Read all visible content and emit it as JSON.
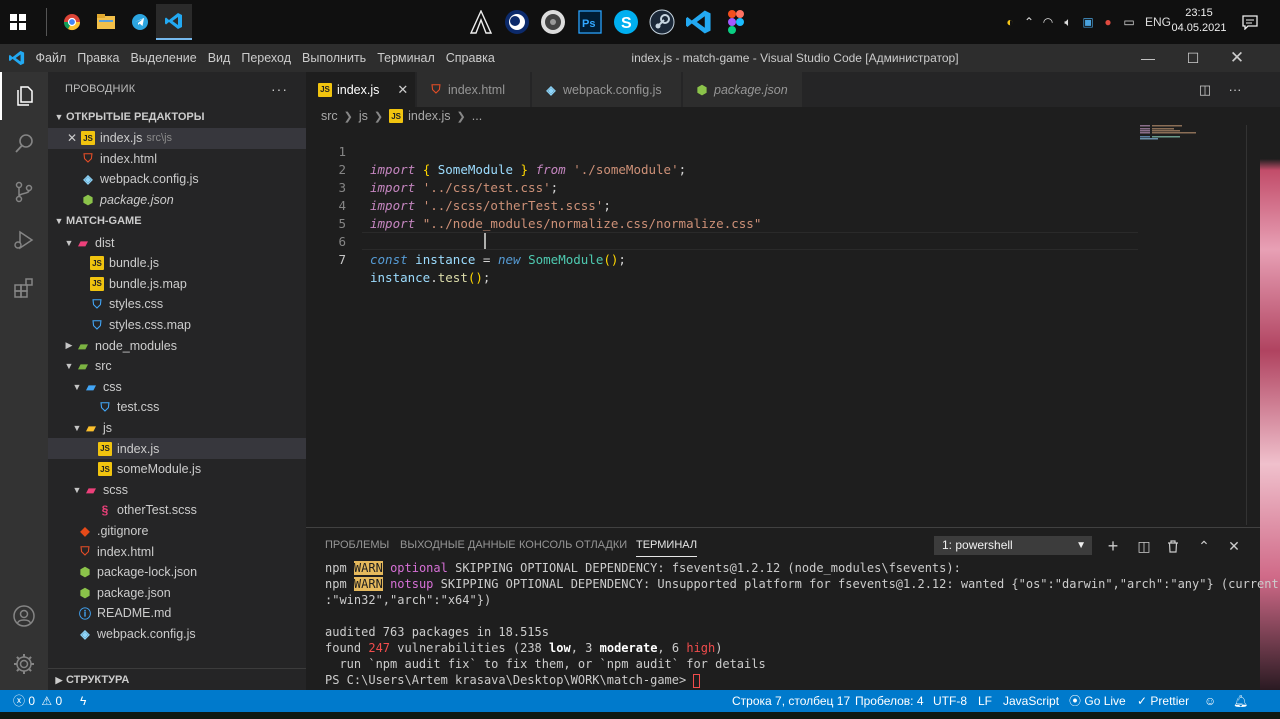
{
  "taskbar": {
    "apps": [
      "chrome-icon",
      "file-explorer-icon",
      "telegram-icon",
      "vscode-icon",
      "assassins-creed-icon",
      "cinema4d-icon",
      "audio-app-icon",
      "photoshop-icon",
      "skype-icon",
      "steam-icon",
      "vscode-icon",
      "figma-icon"
    ],
    "language": "ENG",
    "time": "23:15",
    "date": "04.05.2021"
  },
  "window": {
    "title": "index.js - match-game - Visual Studio Code [Администратор]",
    "menu": [
      "Файл",
      "Правка",
      "Выделение",
      "Вид",
      "Переход",
      "Выполнить",
      "Терминал",
      "Справка"
    ]
  },
  "sidebar": {
    "title": "ПРОВОДНИК",
    "open_editors_title": "ОТКРЫТЫЕ РЕДАКТОРЫ",
    "open_editors": [
      {
        "name": "index.js",
        "desc": "src\\js",
        "icon": "js"
      },
      {
        "name": "index.html",
        "desc": "",
        "icon": "html"
      },
      {
        "name": "webpack.config.js",
        "desc": "",
        "icon": "webpack"
      },
      {
        "name": "package.json",
        "desc": "",
        "icon": "json"
      }
    ],
    "project_title": "MATCH-GAME",
    "tree": [
      {
        "name": "dist"
      },
      {
        "name": "bundle.js"
      },
      {
        "name": "bundle.js.map"
      },
      {
        "name": "styles.css"
      },
      {
        "name": "styles.css.map"
      },
      {
        "name": "node_modules"
      },
      {
        "name": "src"
      },
      {
        "name": "css"
      },
      {
        "name": "test.css"
      },
      {
        "name": "js"
      },
      {
        "name": "index.js"
      },
      {
        "name": "someModule.js"
      },
      {
        "name": "scss"
      },
      {
        "name": "otherTest.scss"
      },
      {
        "name": ".gitignore"
      },
      {
        "name": "index.html"
      },
      {
        "name": "package-lock.json"
      },
      {
        "name": "package.json"
      },
      {
        "name": "README.md"
      },
      {
        "name": "webpack.config.js"
      }
    ],
    "outline_title": "СТРУКТУРА"
  },
  "tabs": [
    {
      "label": "index.js",
      "active": true
    },
    {
      "label": "index.html",
      "active": false
    },
    {
      "label": "webpack.config.js",
      "active": false
    },
    {
      "label": "package.json",
      "active": false
    }
  ],
  "breadcrumb": [
    "src",
    "js",
    "index.js",
    "..."
  ],
  "code": {
    "line_numbers": [
      "1",
      "2",
      "3",
      "4",
      "5",
      "6",
      "7"
    ],
    "tokens": {
      "import": "import",
      "from": "from",
      "const": "const",
      "new": "new",
      "some_module": "SomeModule",
      "instance": "instance",
      "test": "test",
      "path_some": "'./someModule'",
      "path_css": "'../css/test.css'",
      "path_scss": "'../scss/otherTest.scss'",
      "path_normalize": "\"../node_modules/normalize.css/normalize.css\""
    }
  },
  "panel": {
    "tabs": [
      "ПРОБЛЕМЫ",
      "ВЫХОДНЫЕ ДАННЫЕ",
      "КОНСОЛЬ ОТЛАДКИ",
      "ТЕРМИНАЛ"
    ],
    "terminal_select": "1: powershell",
    "terminal": {
      "l1_npm": "npm",
      "warn": "WARN",
      "l1_tag": "optional",
      "l1_text": "SKIPPING OPTIONAL DEPENDENCY: fsevents@1.2.12 (node_modules\\fsevents):",
      "l2_tag": "notsup",
      "l2_text": "SKIPPING OPTIONAL DEPENDENCY: Unsupported platform for fsevents@1.2.12: wanted {\"os\":\"darwin\",\"arch\":\"any\"} (current: {\"os\"",
      "l3_text": ":\"win32\",\"arch\":\"x64\"})",
      "l5_text": "audited 763 packages in 18.515s",
      "l6_found": "found",
      "l6_count": "247",
      "l6_vuln": "vulnerabilities (238",
      "l6_low": "low",
      "l6_comma": ", 3",
      "l6_moderate": "moderate",
      "l6_comma2": ", 6",
      "l6_high": "high",
      "l6_close": ")",
      "l7_text": "  run `npm audit fix` to fix them, or `npm audit` for details",
      "prompt": "PS C:\\Users\\Artem krasava\\Desktop\\WORK\\match-game>"
    }
  },
  "status": {
    "errors": "0",
    "warnings": "0",
    "position": "Строка 7, столбец 17",
    "spaces": "Пробелов: 4",
    "encoding": "UTF-8",
    "eol": "LF",
    "language": "JavaScript",
    "golive": "Go Live",
    "prettier": "Prettier"
  }
}
